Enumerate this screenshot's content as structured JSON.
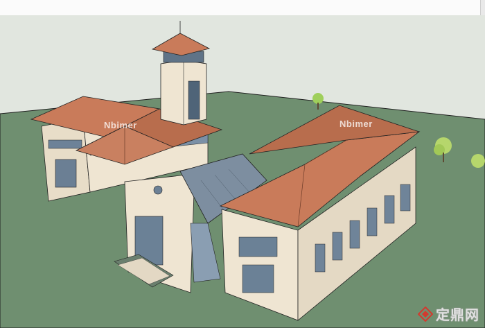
{
  "watermarks": {
    "left": "Nbimer",
    "right": "Nbimer"
  },
  "brand": {
    "text": "定鼎网",
    "logo_icon": "diamond-logo-icon"
  },
  "colors": {
    "sky": "#e1e6df",
    "ground": "#6f8f70",
    "roof": "#c97b5a",
    "wall": "#efe5d2",
    "glass": "#7a8ea0",
    "brand_red": "#d23a2f"
  }
}
